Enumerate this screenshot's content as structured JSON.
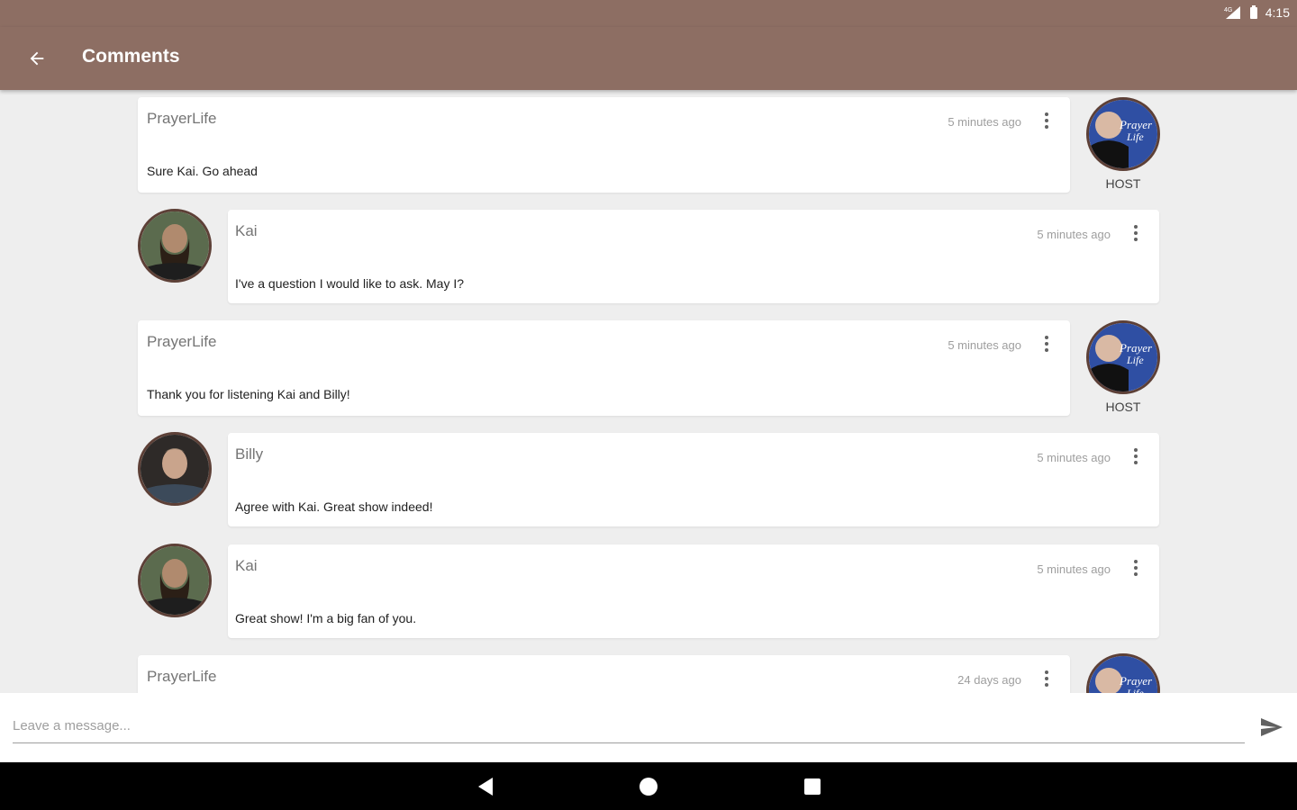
{
  "status_bar": {
    "time": "4:15"
  },
  "app_bar": {
    "title": "Comments",
    "back_icon": "arrow-left-icon"
  },
  "comments": [
    {
      "author": "PrayerLife",
      "time": "5 minutes ago",
      "text": "Sure Kai. Go ahead",
      "side": "right",
      "badge": "HOST",
      "avatar": "prayerlife-host-avatar"
    },
    {
      "author": "Kai",
      "time": "5 minutes ago",
      "text": "I've a question I would like to ask. May I?",
      "side": "left",
      "avatar": "kai-avatar"
    },
    {
      "author": "PrayerLife",
      "time": "5 minutes ago",
      "text": "Thank you for listening Kai and Billy!",
      "side": "right",
      "badge": "HOST",
      "avatar": "prayerlife-host-avatar"
    },
    {
      "author": "Billy",
      "time": "5 minutes ago",
      "text": "Agree with Kai. Great show indeed!",
      "side": "left",
      "avatar": "billy-avatar"
    },
    {
      "author": "Kai",
      "time": "5 minutes ago",
      "text": "Great show! I'm a big fan of you.",
      "side": "left",
      "avatar": "kai-avatar"
    },
    {
      "author": "PrayerLife",
      "time": "24 days ago",
      "text": "",
      "side": "right",
      "avatar": "prayerlife-host-avatar"
    }
  ],
  "composer": {
    "placeholder": "Leave a message...",
    "value": "",
    "send_icon": "send-icon"
  },
  "navigation": {
    "back_icon": "nav-back-icon",
    "home_icon": "nav-home-icon",
    "recents_icon": "nav-recents-icon"
  },
  "colors": {
    "app_bar": "#8d6e63",
    "background": "#eeeeee",
    "host_avatar_bg": "#2f4fa3"
  }
}
